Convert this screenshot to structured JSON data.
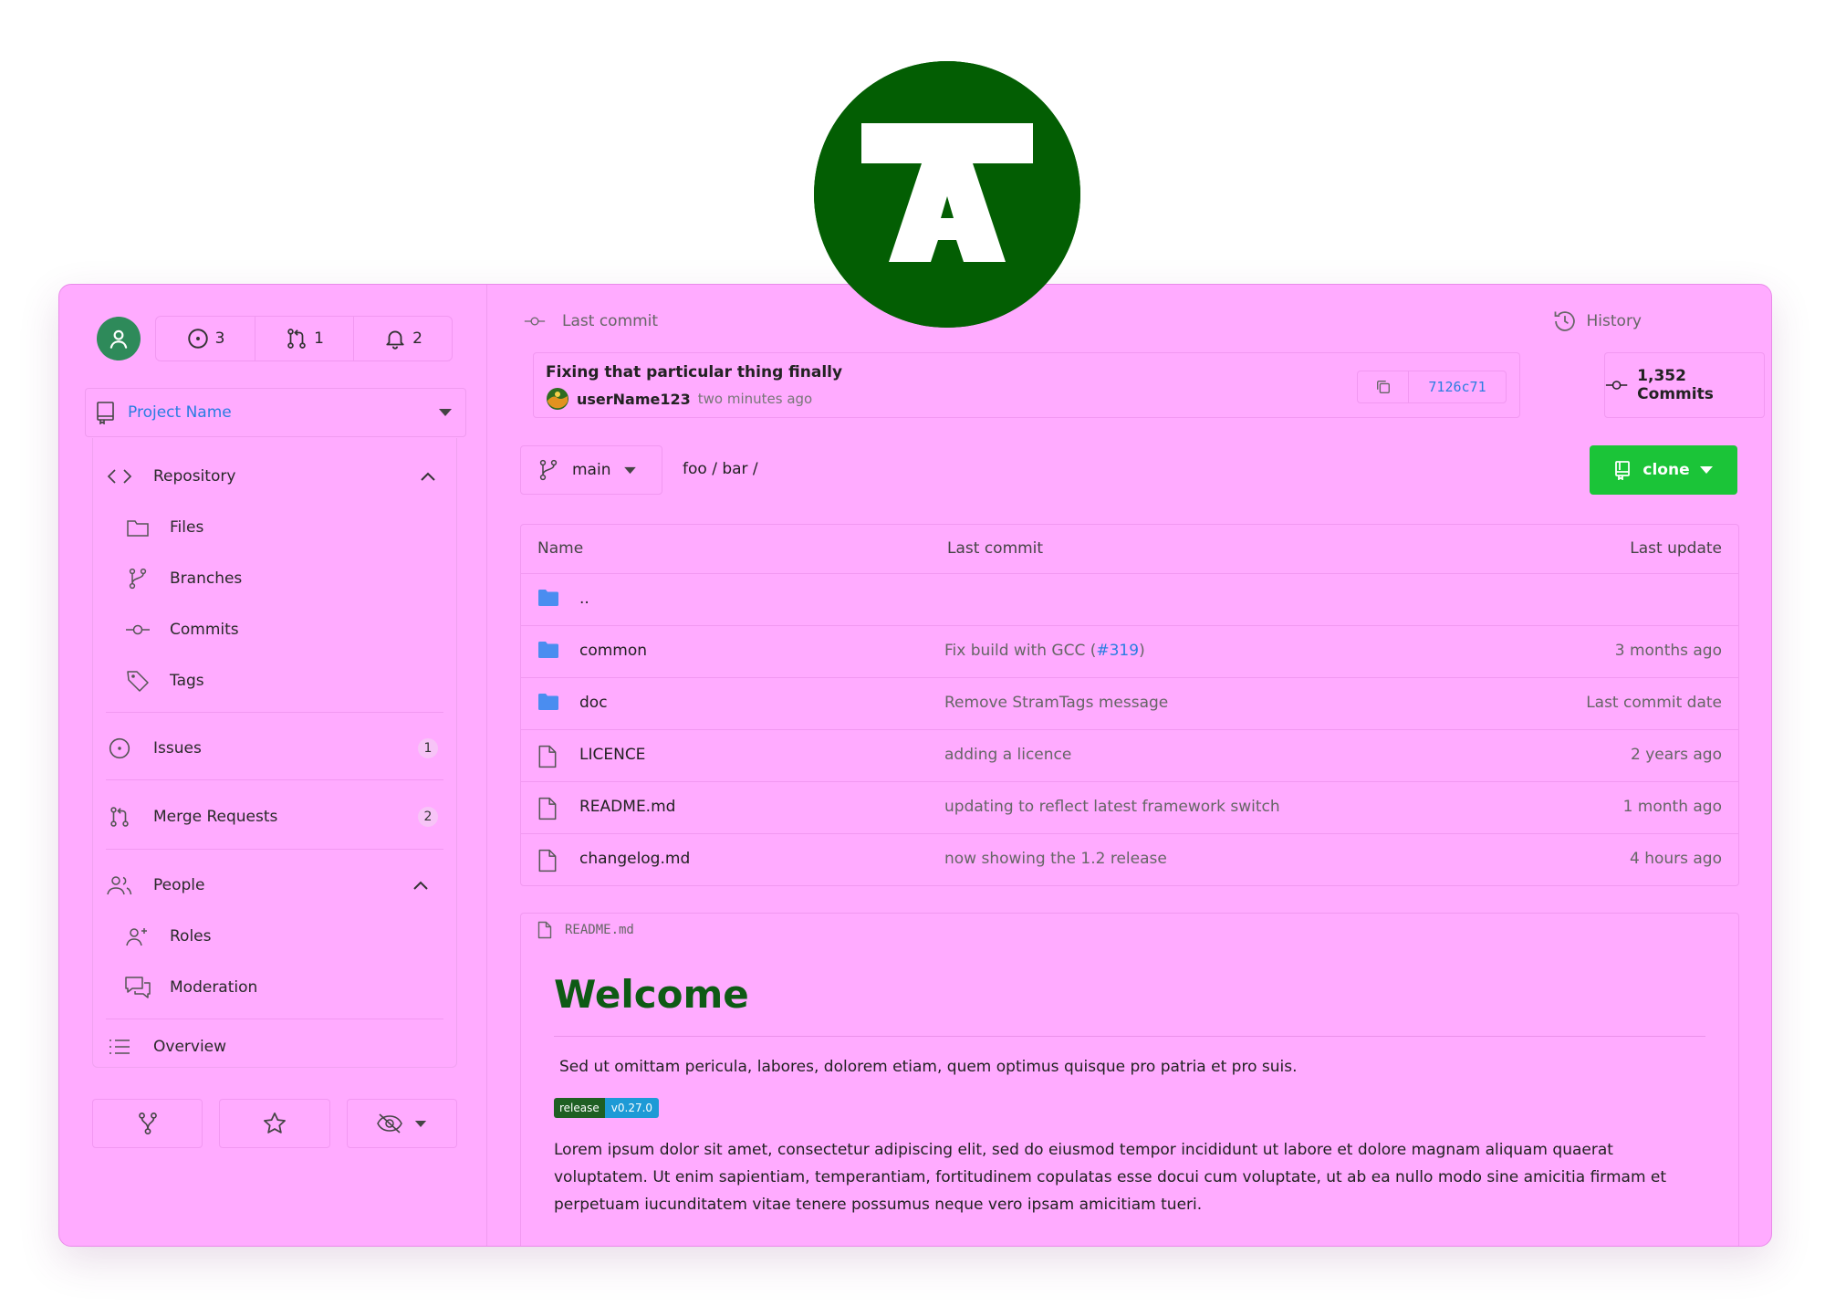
{
  "topbar": {
    "issues_count": "3",
    "merge_requests_count": "1",
    "notifications_count": "2"
  },
  "project": {
    "name": "Project Name"
  },
  "nav": {
    "repository": "Repository",
    "files": "Files",
    "branches": "Branches",
    "commits": "Commits",
    "tags": "Tags",
    "issues": "Issues",
    "issues_badge": "1",
    "merge_requests": "Merge Requests",
    "merge_requests_badge": "2",
    "people": "People",
    "roles": "Roles",
    "moderation": "Moderation",
    "overview": "Overview"
  },
  "last_commit": {
    "heading": "Last commit",
    "title": "Fixing that particular thing finally",
    "author": "userName123",
    "time": "two minutes ago",
    "sha": "7126c71"
  },
  "history": {
    "heading": "History",
    "commits_label": "1,352 Commits"
  },
  "branch": {
    "name": "main"
  },
  "path": "foo / bar /",
  "clone_label": "clone",
  "files": {
    "headers": {
      "name": "Name",
      "last_commit": "Last commit",
      "last_update": "Last update"
    },
    "rows": [
      {
        "type": "folder",
        "name": "..",
        "message": "",
        "issue": "",
        "message_end": "",
        "date": ""
      },
      {
        "type": "folder",
        "name": "common",
        "message": "Fix build with GCC (",
        "issue": "#319",
        "message_end": ")",
        "date": "3 months ago"
      },
      {
        "type": "folder",
        "name": "doc",
        "message": "Remove StramTags message",
        "issue": "",
        "message_end": "",
        "date": "Last commit date"
      },
      {
        "type": "file",
        "name": "LICENCE",
        "message": "adding a licence",
        "issue": "",
        "message_end": "",
        "date": "2 years ago"
      },
      {
        "type": "file",
        "name": "README.md",
        "message": "updating to reflect latest framework switch",
        "issue": "",
        "message_end": "",
        "date": "1 month ago"
      },
      {
        "type": "file",
        "name": "changelog.md",
        "message": "now showing the 1.2 release",
        "issue": "",
        "message_end": "",
        "date": "4 hours ago"
      }
    ]
  },
  "readme": {
    "filename": "README.md",
    "heading": "Welcome",
    "intro": "Sed ut omittam pericula, labores, dolorem etiam, quem optimus quisque pro patria et pro suis.",
    "badge_label": "release",
    "badge_value": "v0.27.0",
    "body": "Lorem ipsum dolor sit amet, consectetur adipiscing elit, sed do eiusmod tempor incididunt ut labore et dolore magnam aliquam quaerat voluptatem. Ut enim sapientiam, temperantiam, fortitudinem copulatas esse docui cum voluptate, ut ab ea nullo modo sine amicitia firmam et perpetuam iucunditatem vitae tenere possumus neque vero ipsam amicitiam tueri."
  },
  "colors": {
    "app_background": "#ffabff",
    "logo_green": "#035e03",
    "accent_blue": "#2a7de1",
    "clone_green": "#1bc438",
    "heading_green": "#0e5a14"
  },
  "icons": {
    "logo": "brand-logo",
    "user": "user-icon",
    "issue": "issue-icon",
    "merge": "merge-request-icon",
    "bell": "bell-icon",
    "folder": "folder-icon",
    "file": "file-icon",
    "commit": "commit-icon",
    "history": "history-icon",
    "branch": "branch-icon",
    "copy": "copy-icon",
    "fork": "fork-icon",
    "star": "star-icon",
    "watch": "eye-off-icon"
  }
}
